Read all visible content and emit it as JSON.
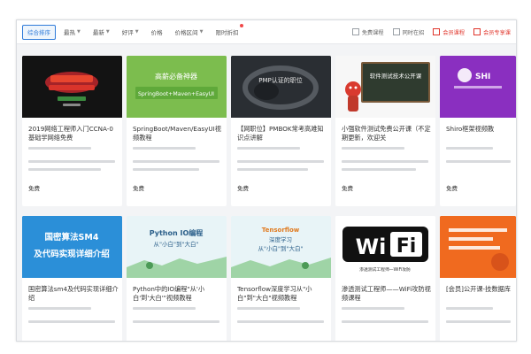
{
  "filters": [
    {
      "label": "综合排序",
      "active": true,
      "caret": false
    },
    {
      "label": "最热",
      "caret": true
    },
    {
      "label": "最新",
      "caret": true
    },
    {
      "label": "好评",
      "caret": true
    },
    {
      "label": "价格",
      "caret": false
    },
    {
      "label": "价格区间",
      "caret": true
    },
    {
      "label": "限时折扣",
      "caret": false,
      "dot": true
    }
  ],
  "checks": [
    {
      "label": "免费课程",
      "red": false
    },
    {
      "label": "同时在招",
      "red": false
    },
    {
      "label": "会员课程",
      "red": true
    },
    {
      "label": "会员专享课",
      "red": true
    }
  ],
  "cards": [
    {
      "title": "2019网络工程师入门CCNA-0基础学网络免费",
      "price": "免费",
      "thumb_text": [],
      "thumb_bg": "#131313"
    },
    {
      "title": "SpringBoot/Maven/EasyUI视频教程",
      "price": "免费",
      "thumb_text": [
        "高薪必备神器",
        "SpringBoot+Maven+EasyUI"
      ],
      "thumb_bg": "#7cbd4e"
    },
    {
      "title": "【网职位】PMBOK常考高难知识点讲解",
      "price": "免费",
      "thumb_text": [
        "PMP认证的职位"
      ],
      "thumb_bg": "#2a2e33"
    },
    {
      "title": "小强软件测试免费公开课（不定期更新，欢迎关",
      "price": "免费",
      "thumb_text": [
        "软件测试技术公开课"
      ],
      "thumb_bg": "#f7f7f7"
    },
    {
      "title": "Shiro框架视频教",
      "price": "免费",
      "thumb_text": [
        "SHI"
      ],
      "thumb_bg": "#8a2fc0"
    },
    {
      "title": "国密算法sm4及代码实现详细介绍",
      "price": "",
      "thumb_text": [
        "国密算法SM4",
        "及代码实现详细介绍"
      ],
      "thumb_bg": "#2b8fd8"
    },
    {
      "title": "Python中的IO编程\"从'小白'到'大白'\"视频教程",
      "price": "",
      "thumb_text": [
        "Python IO编程",
        "从\"小白\"到\"大白\""
      ],
      "thumb_bg": "#e8f4f7"
    },
    {
      "title": "Tensorflow深度学习从\"小白\"到\"大白\"视频教程",
      "price": "",
      "thumb_text": [
        "Tensorflow",
        "深度学习",
        "从\"小白\"到\"大白\""
      ],
      "thumb_bg": "#e8f4f7"
    },
    {
      "title": "渗透测试工程师——WiFi攻防视频课程",
      "price": "",
      "thumb_text": [
        "Wi",
        "Fi",
        "渗透测试工程师—WiFi攻防"
      ],
      "thumb_bg": "#ffffff"
    },
    {
      "title": "[会员]公开课-技数据库",
      "price": "",
      "thumb_text": [],
      "thumb_bg": "#f06a1f"
    }
  ]
}
